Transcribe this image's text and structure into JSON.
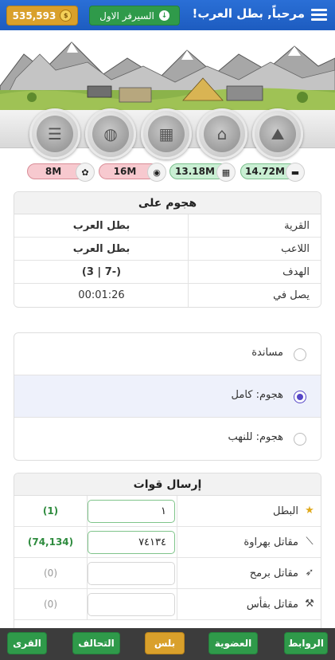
{
  "header": {
    "welcome": "مرحباً, بطل العرب!",
    "server_label": "السيرفر الاول",
    "gold": "535,593",
    "gold_icon": "coin-icon"
  },
  "buildings": [
    {
      "name": "resources-building",
      "glyph": "⛰"
    },
    {
      "name": "hut-building",
      "glyph": "⌂"
    },
    {
      "name": "map-building",
      "glyph": "▦"
    },
    {
      "name": "storage-building",
      "glyph": "◍"
    },
    {
      "name": "scroll-building",
      "glyph": "☰"
    }
  ],
  "resources": [
    {
      "value": "14.72M",
      "icon": "wood-icon",
      "color": "#c9efd3"
    },
    {
      "value": "13.18M",
      "icon": "clay-icon",
      "color": "#c9efd3"
    },
    {
      "value": "16M",
      "icon": "iron-icon",
      "color": "#f7c9cf"
    },
    {
      "value": "8M",
      "icon": "wheat-icon",
      "color": "#f7c9cf"
    }
  ],
  "attack": {
    "title": "هجوم على",
    "rows": [
      {
        "label": "القرية",
        "value": "بطل العرب",
        "green": true
      },
      {
        "label": "اللاعب",
        "value": "بطل العرب",
        "green": true
      },
      {
        "label": "الهدف",
        "value": "(-7 | 3)",
        "green": true
      },
      {
        "label": "يصل في",
        "value": "00:01:26",
        "green": false
      }
    ]
  },
  "options": [
    {
      "label": "مساندة",
      "selected": false
    },
    {
      "label": "هجوم: كامل",
      "selected": true
    },
    {
      "label": "هجوم: للنهب",
      "selected": false
    }
  ],
  "troops": {
    "title": "إرسال قوات",
    "rows": [
      {
        "label": "البطل",
        "icon": "star-icon",
        "glyph": "★",
        "input": "١",
        "count": "(1)",
        "green": true
      },
      {
        "label": "مقاتل بهراوة",
        "icon": "club-icon",
        "glyph": "⟋",
        "input": "٧٤١٣٤",
        "count": "(74,134)",
        "green": true
      },
      {
        "label": "مقاتل برمح",
        "icon": "spear-icon",
        "glyph": "➶",
        "input": "",
        "count": "(0)",
        "green": false
      },
      {
        "label": "مقاتل بفأس",
        "icon": "axe-icon",
        "glyph": "⚒",
        "input": "",
        "count": "(0)",
        "green": false
      }
    ]
  },
  "bottom_nav": [
    "الروابط",
    "العضوية",
    "بلس",
    "التحالف",
    "القرى"
  ],
  "colors": {
    "accent_blue": "#1d5cc0",
    "green": "#2f9a4a",
    "gold": "#d9a02b",
    "radio": "#5646c7"
  }
}
